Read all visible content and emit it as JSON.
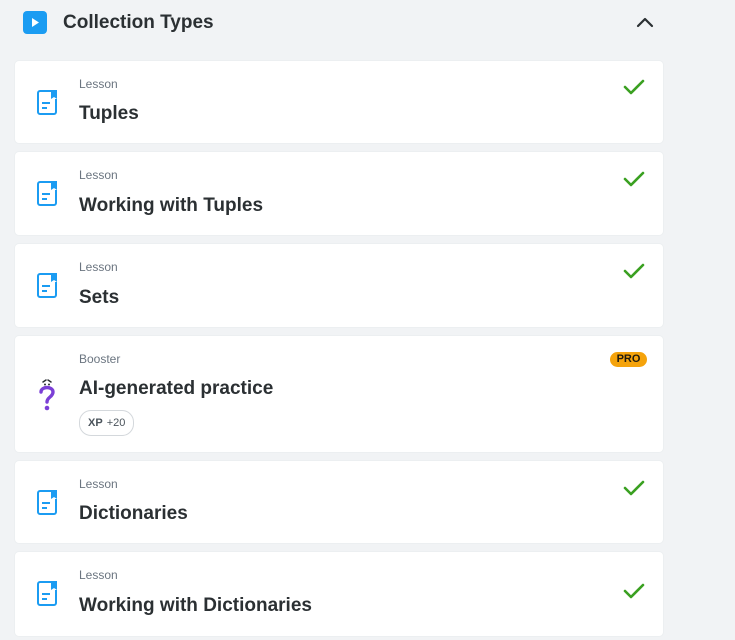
{
  "section": {
    "title": "Collection Types",
    "play_icon": "play-icon",
    "collapse_icon": "chevron-up-icon"
  },
  "items": [
    {
      "type": "Lesson",
      "title": "Tuples",
      "icon": "document-icon",
      "completed": true
    },
    {
      "type": "Lesson",
      "title": "Working with Tuples",
      "icon": "document-icon",
      "completed": true
    },
    {
      "type": "Lesson",
      "title": "Sets",
      "icon": "document-icon",
      "completed": true
    },
    {
      "type": "Booster",
      "title": "AI-generated practice",
      "icon": "question-mark-icon",
      "badge": "PRO",
      "xp_label": "XP",
      "xp_value": "+20"
    },
    {
      "type": "Lesson",
      "title": "Dictionaries",
      "icon": "document-icon",
      "completed": true
    },
    {
      "type": "Lesson",
      "title": "Working with Dictionaries",
      "icon": "document-icon",
      "completed": true
    }
  ],
  "colors": {
    "accent_blue": "#1b9cf2",
    "check_green": "#3aa021",
    "pro_orange": "#f5a30b",
    "booster_purple": "#7b3fd6"
  }
}
